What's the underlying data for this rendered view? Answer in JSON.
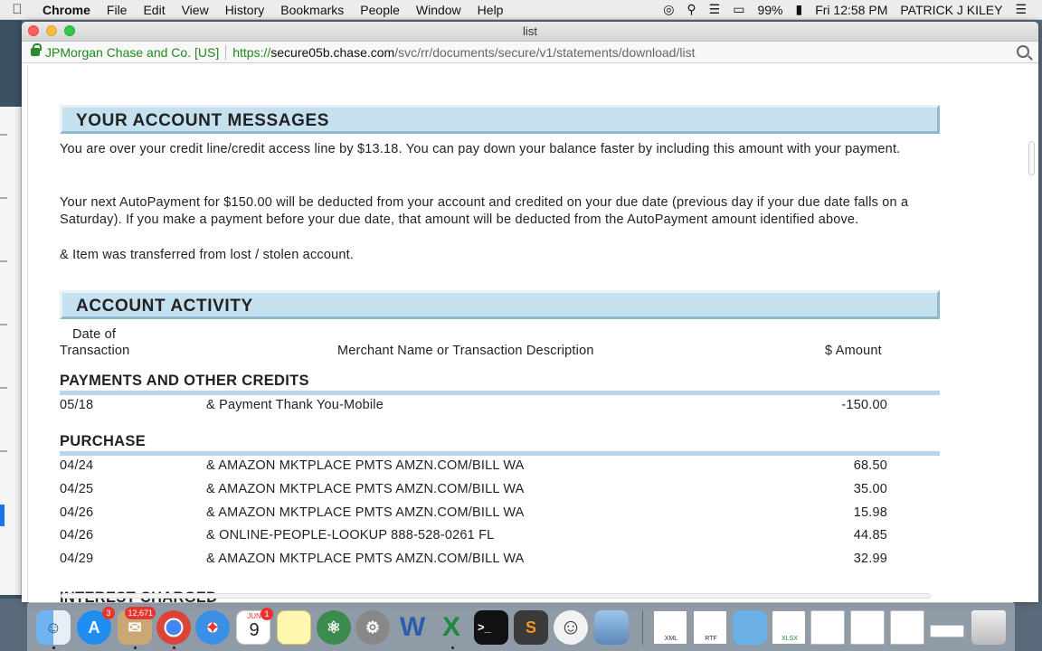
{
  "menubar": {
    "app_name": "Chrome",
    "menus": [
      "File",
      "Edit",
      "View",
      "History",
      "Bookmarks",
      "People",
      "Window",
      "Help"
    ],
    "battery": "99%",
    "clock": "Fri 12:58 PM",
    "user": "PATRICK J KILEY"
  },
  "window": {
    "title": "list"
  },
  "address": {
    "org": "JPMorgan Chase and Co. [US]",
    "scheme": "https://",
    "host": "secure05b.chase.com",
    "path": "/svc/rr/documents/secure/v1/statements/download/list"
  },
  "statement": {
    "messages_header": "YOUR ACCOUNT MESSAGES",
    "messages": [
      "You are over your credit line/credit access line by $13.18.  You can pay down your balance faster by including this amount with your payment.",
      "Your next AutoPayment for $150.00 will be deducted from your account and credited on your due date (previous day if your due date falls on a Saturday).  If you make a payment before your due date, that amount will be deducted from the AutoPayment amount identified above.",
      "& Item was transferred from lost / stolen account."
    ],
    "activity_header": "ACCOUNT ACTIVITY",
    "col_date_line1": "Date of",
    "col_date_line2": "Transaction",
    "col_desc": "Merchant Name or  Transaction Description",
    "col_amount": "$ Amount",
    "payments_header": "PAYMENTS AND OTHER CREDITS",
    "payments": [
      {
        "date": "05/18",
        "desc": "& Payment Thank You-Mobile",
        "amount": "-150.00"
      }
    ],
    "purchase_header": "PURCHASE",
    "purchases": [
      {
        "date": "04/24",
        "desc": "& AMAZON MKTPLACE PMTS AMZN.COM/BILL WA",
        "amount": "68.50"
      },
      {
        "date": "04/25",
        "desc": "& AMAZON MKTPLACE PMTS AMZN.COM/BILL WA",
        "amount": "35.00"
      },
      {
        "date": "04/26",
        "desc": "& AMAZON MKTPLACE PMTS AMZN.COM/BILL WA",
        "amount": "15.98"
      },
      {
        "date": "04/26",
        "desc": "& ONLINE-PEOPLE-LOOKUP 888-528-0261 FL",
        "amount": "44.85"
      },
      {
        "date": "04/29",
        "desc": "& AMAZON MKTPLACE PMTS AMZN.COM/BILL WA",
        "amount": "32.99"
      }
    ],
    "interest_header": "INTEREST CHARGED"
  },
  "dock": {
    "appstore_badge": "3",
    "mail_badge": "12,671",
    "calendar_month": "JUN",
    "calendar_day": "9",
    "calendar_badge": "1",
    "xml_label": "XML",
    "rtf_label": "RTF",
    "xlsx_label": "XLSX"
  },
  "colors": {
    "header_fill": "#c5e0ee",
    "rule": "#b9d7e8",
    "secure_green": "#1e8a1e"
  }
}
